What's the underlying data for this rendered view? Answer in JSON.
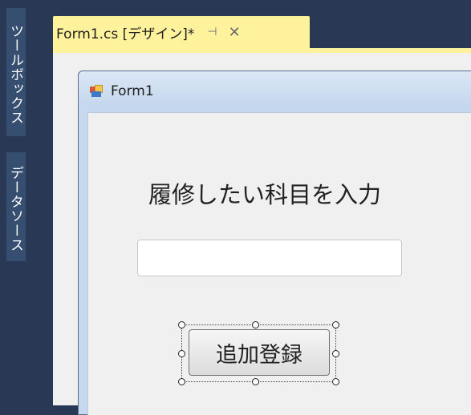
{
  "toolbox_strip": {
    "toolbox_label": "ツールボックス",
    "datasource_label": "データソース"
  },
  "document_tab": {
    "title": "Form1.cs [デザイン]*",
    "pin_icon": "pin-icon",
    "close_icon": "close-icon"
  },
  "form": {
    "title": "Form1",
    "icon": "form-window-icon",
    "label_text": "履修したい科目を入力",
    "textbox_value": "",
    "button_label": "追加登録"
  }
}
